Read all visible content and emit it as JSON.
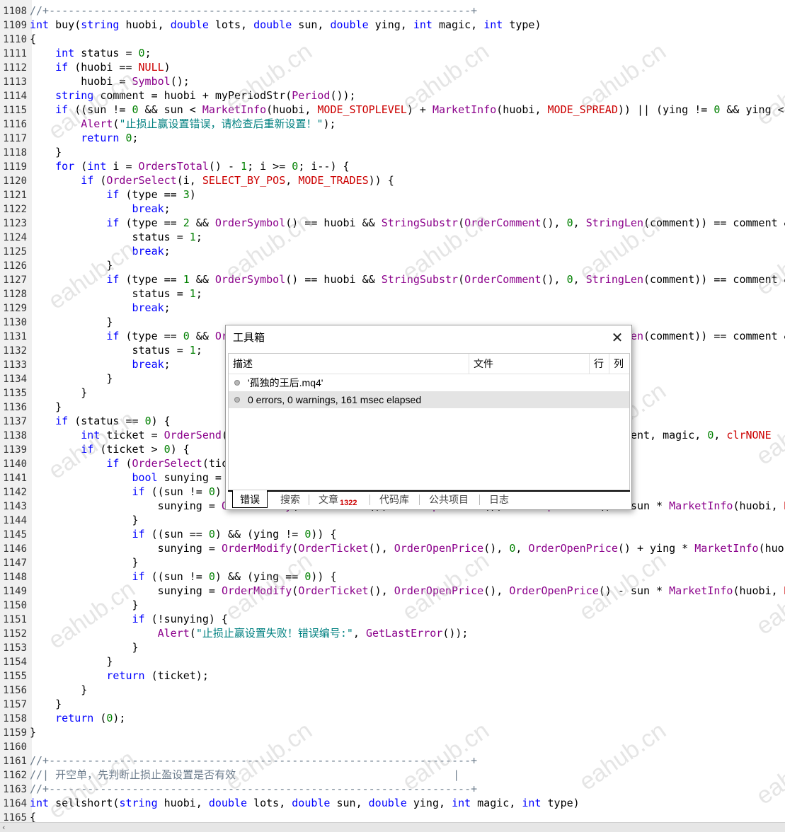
{
  "editor": {
    "lines": [
      {
        "num": "1108",
        "html": "<span class=\"c\">//+------------------------------------------------------------------+</span>"
      },
      {
        "num": "1109",
        "html": "<span class=\"k\">int</span> buy(<span class=\"k\">string</span> huobi, <span class=\"k\">double</span> lots, <span class=\"k\">double</span> sun, <span class=\"k\">double</span> ying, <span class=\"k\">int</span> magic, <span class=\"k\">int</span> type)"
      },
      {
        "num": "1110",
        "html": "{"
      },
      {
        "num": "1111",
        "html": "    <span class=\"k\">int</span> status = <span class=\"n\">0</span>;"
      },
      {
        "num": "1112",
        "html": "    <span class=\"k\">if</span> (huobi == <span class=\"r\">NULL</span>)"
      },
      {
        "num": "1113",
        "html": "        huobi = <span class=\"f\">Symbol</span>();"
      },
      {
        "num": "1114",
        "html": "    <span class=\"k\">string</span> comment = huobi + myPeriodStr(<span class=\"f\">Period</span>());"
      },
      {
        "num": "1115",
        "html": "    <span class=\"k\">if</span> ((sun != <span class=\"n\">0</span> &amp;&amp; sun &lt; <span class=\"f\">MarketInfo</span>(huobi, <span class=\"r\">MODE_STOPLEVEL</span>) + <span class=\"f\">MarketInfo</span>(huobi, <span class=\"r\">MODE_SPREAD</span>)) || (ying != <span class=\"n\">0</span> &amp;&amp; ying &lt;"
      },
      {
        "num": "1116",
        "html": "        <span class=\"f\">Alert</span>(<span class=\"s\">\"止损止赢设置错误，请检查后重新设置！\"</span>);"
      },
      {
        "num": "1117",
        "html": "        <span class=\"k\">return</span> <span class=\"n\">0</span>;"
      },
      {
        "num": "1118",
        "html": "    }"
      },
      {
        "num": "1119",
        "html": "    <span class=\"k\">for</span> (<span class=\"k\">int</span> i = <span class=\"f\">OrdersTotal</span>() - <span class=\"n\">1</span>; i &gt;= <span class=\"n\">0</span>; i--) {"
      },
      {
        "num": "1120",
        "html": "        <span class=\"k\">if</span> (<span class=\"f\">OrderSelect</span>(i, <span class=\"r\">SELECT_BY_POS</span>, <span class=\"r\">MODE_TRADES</span>)) {"
      },
      {
        "num": "1121",
        "html": "            <span class=\"k\">if</span> (type == <span class=\"n\">3</span>)"
      },
      {
        "num": "1122",
        "html": "                <span class=\"k\">break</span>;"
      },
      {
        "num": "1123",
        "html": "            <span class=\"k\">if</span> (type == <span class=\"n\">2</span> &amp;&amp; <span class=\"f\">OrderSymbol</span>() == huobi &amp;&amp; <span class=\"f\">StringSubstr</span>(<span class=\"f\">OrderComment</span>(), <span class=\"n\">0</span>, <span class=\"f\">StringLen</span>(comment)) == comment &amp;"
      },
      {
        "num": "1124",
        "html": "                status = <span class=\"n\">1</span>;"
      },
      {
        "num": "1125",
        "html": "                <span class=\"k\">break</span>;"
      },
      {
        "num": "1126",
        "html": "            }"
      },
      {
        "num": "1127",
        "html": "            <span class=\"k\">if</span> (type == <span class=\"n\">1</span> &amp;&amp; <span class=\"f\">OrderSymbol</span>() == huobi &amp;&amp; <span class=\"f\">StringSubstr</span>(<span class=\"f\">OrderComment</span>(), <span class=\"n\">0</span>, <span class=\"f\">StringLen</span>(comment)) == comment &amp;"
      },
      {
        "num": "1128",
        "html": "                status = <span class=\"n\">1</span>;"
      },
      {
        "num": "1129",
        "html": "                <span class=\"k\">break</span>;"
      },
      {
        "num": "1130",
        "html": "            }"
      },
      {
        "num": "1131",
        "html": "            <span class=\"k\">if</span> (type == <span class=\"n\">0</span> &amp;&amp; <span class=\"f\">OrderSymbol</span>() == huobi &amp;&amp; <span class=\"f\">StringSubstr</span>(<span class=\"f\">OrderComment</span>(), <span class=\"n\">0</span>, <span class=\"f\">StringLen</span>(comment)) == comment &amp;"
      },
      {
        "num": "1132",
        "html": "                status = <span class=\"n\">1</span>;"
      },
      {
        "num": "1133",
        "html": "                <span class=\"k\">break</span>;"
      },
      {
        "num": "1134",
        "html": "            }"
      },
      {
        "num": "1135",
        "html": "        }"
      },
      {
        "num": "1136",
        "html": "    }"
      },
      {
        "num": "1137",
        "html": "    <span class=\"k\">if</span> (status == <span class=\"n\">0</span>) {"
      },
      {
        "num": "1138",
        "html": "        <span class=\"k\">int</span> ticket = <span class=\"f\">OrderSend</span>(huobi, <span class=\"r\">OP_BUY</span>, lots, <span class=\"f\">MarketInfo</span>(huobi, <span class=\"r\">MODE_ASK</span>), <span class=\"n\">3</span>, <span class=\"n\">0</span>, <span class=\"n\">0</span>, comment, magic, <span class=\"n\">0</span>, <span class=\"r\">clrNONE</span>"
      },
      {
        "num": "1139",
        "html": "        <span class=\"k\">if</span> (ticket &gt; <span class=\"n\">0</span>) {"
      },
      {
        "num": "1140",
        "html": "            <span class=\"k\">if</span> (<span class=\"f\">OrderSelect</span>(ticket, <span class=\"r\">SELECT_BY_TICKET</span>)) {"
      },
      {
        "num": "1141",
        "html": "                <span class=\"k\">bool</span> sunying = <span class=\"k\">true</span>;"
      },
      {
        "num": "1142",
        "html": "                <span class=\"k\">if</span> ((sun != <span class=\"n\">0</span>) &amp;&amp; (ying != <span class=\"n\">0</span>)) {"
      },
      {
        "num": "1143",
        "html": "                    sunying = <span class=\"f\">OrderModify</span>(<span class=\"f\">OrderTicket</span>(), <span class=\"f\">OrderOpenPrice</span>(), <span class=\"f\">OrderOpenPrice</span>() - sun * <span class=\"f\">MarketInfo</span>(huobi, <span class=\"r\">M</span>"
      },
      {
        "num": "1144",
        "html": "                }"
      },
      {
        "num": "1145",
        "html": "                <span class=\"k\">if</span> ((sun == <span class=\"n\">0</span>) &amp;&amp; (ying != <span class=\"n\">0</span>)) {"
      },
      {
        "num": "1146",
        "html": "                    sunying = <span class=\"f\">OrderModify</span>(<span class=\"f\">OrderTicket</span>(), <span class=\"f\">OrderOpenPrice</span>(), <span class=\"n\">0</span>, <span class=\"f\">OrderOpenPrice</span>() + ying * <span class=\"f\">MarketInfo</span>(huo"
      },
      {
        "num": "1147",
        "html": "                }"
      },
      {
        "num": "1148",
        "html": "                <span class=\"k\">if</span> ((sun != <span class=\"n\">0</span>) &amp;&amp; (ying == <span class=\"n\">0</span>)) {"
      },
      {
        "num": "1149",
        "html": "                    sunying = <span class=\"f\">OrderModify</span>(<span class=\"f\">OrderTicket</span>(), <span class=\"f\">OrderOpenPrice</span>(), <span class=\"f\">OrderOpenPrice</span>() - sun * <span class=\"f\">MarketInfo</span>(huobi, <span class=\"r\">M</span>"
      },
      {
        "num": "1150",
        "html": "                }"
      },
      {
        "num": "1151",
        "html": "                <span class=\"k\">if</span> (!sunying) {"
      },
      {
        "num": "1152",
        "html": "                    <span class=\"f\">Alert</span>(<span class=\"s\">\"止损止赢设置失败！错误编号:\"</span>, <span class=\"f\">GetLastError</span>());"
      },
      {
        "num": "1153",
        "html": "                }"
      },
      {
        "num": "1154",
        "html": "            }"
      },
      {
        "num": "1155",
        "html": "            <span class=\"k\">return</span> (ticket);"
      },
      {
        "num": "1156",
        "html": "        }"
      },
      {
        "num": "1157",
        "html": "    }"
      },
      {
        "num": "1158",
        "html": "    <span class=\"k\">return</span> (<span class=\"n\">0</span>);"
      },
      {
        "num": "1159",
        "html": "}"
      },
      {
        "num": "1160",
        "html": ""
      },
      {
        "num": "1161",
        "html": "<span class=\"c\">//+------------------------------------------------------------------+</span>"
      },
      {
        "num": "1162",
        "html": "<span class=\"c\">//| 开空单，先判断止损止盈设置是否有效                                  |</span>"
      },
      {
        "num": "1163",
        "html": "<span class=\"c\">//+------------------------------------------------------------------+</span>"
      },
      {
        "num": "1164",
        "html": "<span class=\"k\">int</span> sellshort(<span class=\"k\">string</span> huobi, <span class=\"k\">double</span> lots, <span class=\"k\">double</span> sun, <span class=\"k\">double</span> ying, <span class=\"k\">int</span> magic, <span class=\"k\">int</span> type)"
      },
      {
        "num": "1165",
        "html": "{"
      }
    ]
  },
  "watermark": "eahub.cn",
  "dialog": {
    "title": "工具箱",
    "close_icon": "close-icon",
    "columns": {
      "desc": "描述",
      "file": "文件",
      "line": "行",
      "col": "列"
    },
    "rows": [
      {
        "text": "'孤独的王后.mq4'",
        "icon": "info-dot-icon"
      },
      {
        "text": "0 errors, 0 warnings, 161 msec elapsed",
        "icon": "info-dot-icon"
      }
    ],
    "tabs": {
      "errors": "错误",
      "search": "搜索",
      "articles": "文章",
      "articles_badge": "1322",
      "codebase": "代码库",
      "projects": "公共项目",
      "journal": "日志"
    }
  },
  "scrollbar": {
    "left_arrow": "‹"
  }
}
